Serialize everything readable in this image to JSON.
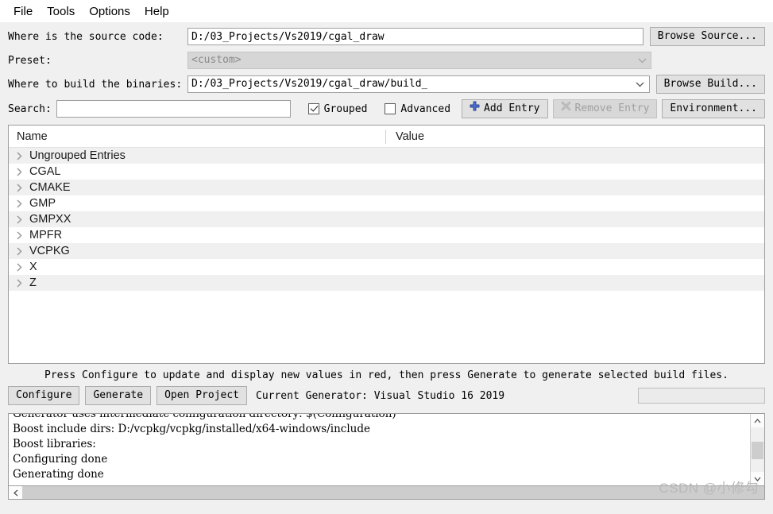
{
  "menu": {
    "items": [
      {
        "label": "File"
      },
      {
        "label": "Tools"
      },
      {
        "label": "Options"
      },
      {
        "label": "Help"
      }
    ]
  },
  "form": {
    "source_label": "Where is the source code:",
    "source_value": "D:/03_Projects/Vs2019/cgal_draw",
    "browse_source_label": "Browse Source...",
    "preset_label": "Preset:",
    "preset_value": "<custom>",
    "build_label": "Where to build the binaries:",
    "build_value": "D:/03_Projects/Vs2019/cgal_draw/build_",
    "browse_build_label": "Browse Build..."
  },
  "search": {
    "label": "Search:",
    "value": "",
    "placeholder": "",
    "grouped_label": "Grouped",
    "grouped_checked": true,
    "advanced_label": "Advanced",
    "advanced_checked": false,
    "add_entry_label": "Add Entry",
    "remove_entry_label": "Remove Entry",
    "remove_entry_disabled": true,
    "environment_label": "Environment..."
  },
  "cache": {
    "columns": [
      "Name",
      "Value"
    ],
    "rows": [
      {
        "name": "Ungrouped Entries",
        "value": ""
      },
      {
        "name": "CGAL",
        "value": ""
      },
      {
        "name": "CMAKE",
        "value": ""
      },
      {
        "name": "GMP",
        "value": ""
      },
      {
        "name": "GMPXX",
        "value": ""
      },
      {
        "name": "MPFR",
        "value": ""
      },
      {
        "name": "VCPKG",
        "value": ""
      },
      {
        "name": "X",
        "value": ""
      },
      {
        "name": "Z",
        "value": ""
      }
    ]
  },
  "hint": "Press Configure to update and display new values in red, then press Generate to generate selected build files.",
  "actions": {
    "configure_label": "Configure",
    "generate_label": "Generate",
    "open_project_label": "Open Project",
    "generator_label": "Current Generator: Visual Studio 16 2019",
    "progress_value": ""
  },
  "console": {
    "lines": [
      "Generator uses intermediate configuration directory: $(Configuration)",
      "Boost include dirs: D:/vcpkg/vcpkg/installed/x64-windows/include",
      "Boost libraries:",
      "Configuring done",
      "Generating done"
    ]
  },
  "watermark": "CSDN @小修勾",
  "colors": {
    "window_bg": "#f0f0f0",
    "field_bg": "#ffffff",
    "button_bg": "#e1e1e1",
    "accent_blue": "#3b5fbe",
    "disabled_text": "#a0a0a0",
    "row_stripe": "#f0f0f0"
  }
}
